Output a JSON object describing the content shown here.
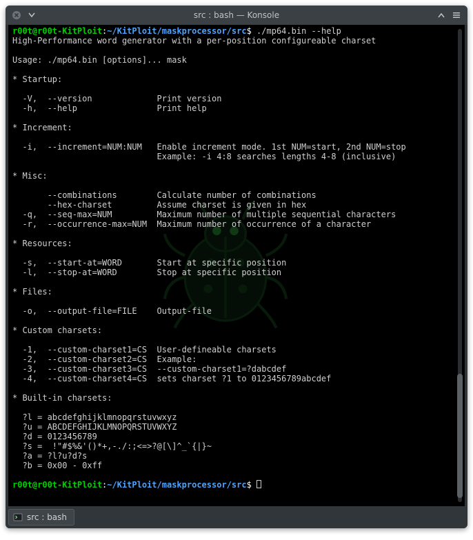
{
  "titlebar": {
    "title": "src : bash — Konsole"
  },
  "prompt": {
    "user_host": "r00t@r00t-KitPloit",
    "separator": ":",
    "path": "~/KitPloit/maskprocessor/src",
    "symbol": "$"
  },
  "command": {
    "text": "./mp64.bin --help"
  },
  "output": {
    "line01": "High-Performance word generator with a per-position configureable charset",
    "blank1": "",
    "line02": "Usage: ./mp64.bin [options]... mask",
    "blank2": "",
    "sec_startup": "* Startup:",
    "blank3": "",
    "opt_V": "  -V,  --version             Print version",
    "opt_h": "  -h,  --help                Print help",
    "blank4": "",
    "sec_increment": "* Increment:",
    "blank5": "",
    "opt_i1": "  -i,  --increment=NUM:NUM   Enable increment mode. 1st NUM=start, 2nd NUM=stop",
    "opt_i2": "                             Example: -i 4:8 searches lengths 4-8 (inclusive)",
    "blank6": "",
    "sec_misc": "* Misc:",
    "blank7": "",
    "opt_comb": "       --combinations        Calculate number of combinations",
    "opt_hex": "       --hex-charset         Assume charset is given in hex",
    "opt_q": "  -q,  --seq-max=NUM         Maximum number of multiple sequential characters",
    "opt_r": "  -r,  --occurrence-max=NUM  Maximum number of occurrence of a character",
    "blank8": "",
    "sec_res": "* Resources:",
    "blank9": "",
    "opt_s": "  -s,  --start-at=WORD       Start at specific position",
    "opt_l": "  -l,  --stop-at=WORD        Stop at specific position",
    "blank10": "",
    "sec_files": "* Files:",
    "blank11": "",
    "opt_o": "  -o,  --output-file=FILE    Output-file",
    "blank12": "",
    "sec_custom": "* Custom charsets:",
    "blank13": "",
    "opt_1": "  -1,  --custom-charset1=CS  User-defineable charsets",
    "opt_2": "  -2,  --custom-charset2=CS  Example:",
    "opt_3": "  -3,  --custom-charset3=CS  --custom-charset1=?dabcdef",
    "opt_4": "  -4,  --custom-charset4=CS  sets charset ?1 to 0123456789abcdef",
    "blank14": "",
    "sec_builtin": "* Built-in charsets:",
    "blank15": "",
    "bi_l": "  ?l = abcdefghijklmnopqrstuvwxyz",
    "bi_u": "  ?u = ABCDEFGHIJKLMNOPQRSTUVWXYZ",
    "bi_d": "  ?d = 0123456789",
    "bi_s": "  ?s =  !\"#$%&'()*+,-./:;<=>?@[\\]^_`{|}~",
    "bi_a": "  ?a = ?l?u?d?s",
    "bi_b": "  ?b = 0x00 - 0xff",
    "blank16": ""
  },
  "tab": {
    "label": "src : bash"
  }
}
